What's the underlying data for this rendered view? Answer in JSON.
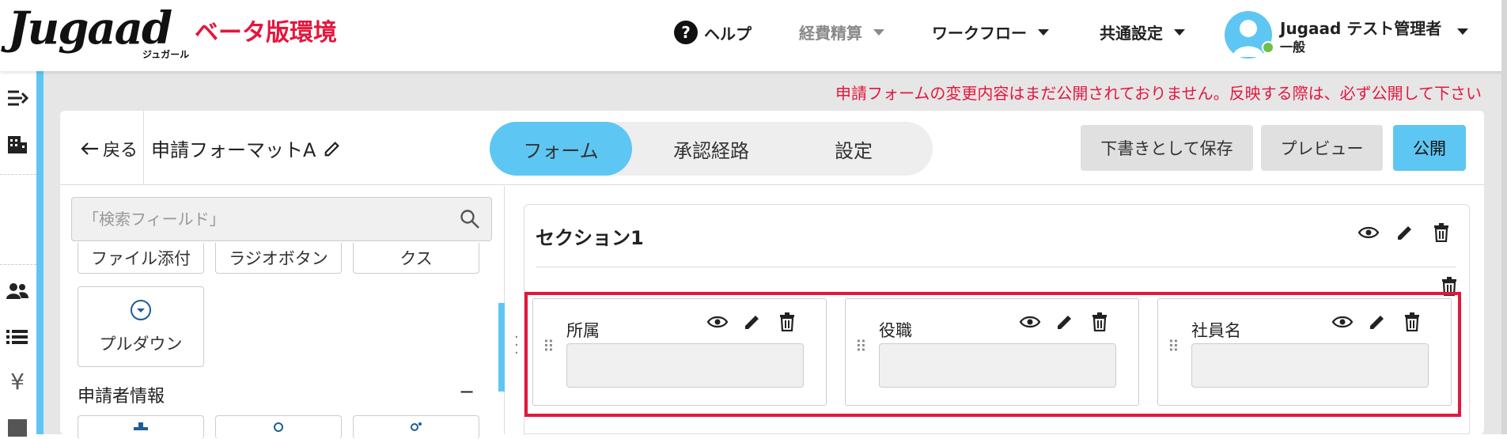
{
  "header": {
    "logo_text": "Jugaad",
    "logo_subtext": "ジュガール",
    "env_label": "ベータ版環境",
    "nav": [
      {
        "label": "ヘルプ"
      },
      {
        "label": "経費精算"
      },
      {
        "label": "ワークフロー"
      },
      {
        "label": "共通設定"
      }
    ],
    "user": {
      "name": "Jugaad テスト管理者",
      "role": "一般"
    }
  },
  "warning": "申請フォームの変更内容はまだ公開されておりません。反映する際は、必ず公開して下さい",
  "editor": {
    "back_label": "戻る",
    "format_name": "申請フォーマットA",
    "tabs": [
      {
        "label": "フォーム",
        "active": true
      },
      {
        "label": "承認経路",
        "active": false
      },
      {
        "label": "設定",
        "active": false
      }
    ],
    "buttons": {
      "draft": "下書きとして保存",
      "preview": "プレビュー",
      "publish": "公開"
    }
  },
  "palette": {
    "search_placeholder": "「検索フィールド」",
    "items_row1": [
      "ファイル添付",
      "ラジオボタン",
      "クス"
    ],
    "dropdown_label": "プルダウン",
    "applicant_heading": "申請者情報",
    "collapse_symbol": "−"
  },
  "form": {
    "section_title": "セクション1",
    "fields": [
      {
        "label": "所属"
      },
      {
        "label": "役職"
      },
      {
        "label": "社員名"
      }
    ]
  },
  "colors": {
    "accent": "#5ec6f2",
    "brand_red": "#e3173e",
    "online": "#6cc04a"
  }
}
